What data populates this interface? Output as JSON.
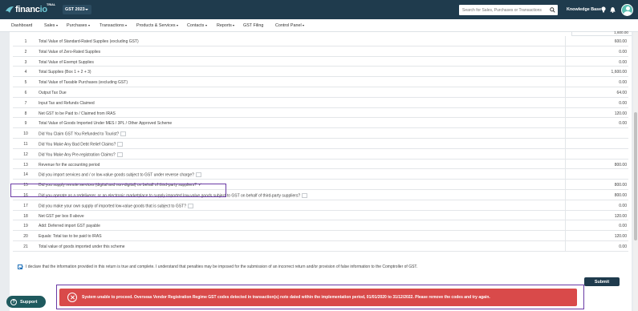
{
  "header": {
    "logo_text_a": "financ",
    "logo_text_b": "io",
    "trial_badge": "TRIAL",
    "gst_period": "GST 2023",
    "search_placeholder": "Search for Sales, Purchases or Transactions",
    "knowledge_base": "Knowledge Base"
  },
  "nav": [
    {
      "label": "Dashboard",
      "dropdown": false
    },
    {
      "label": "Sales",
      "dropdown": true
    },
    {
      "label": "Purchases",
      "dropdown": true
    },
    {
      "label": "Transactions",
      "dropdown": true
    },
    {
      "label": "Products & Services",
      "dropdown": true
    },
    {
      "label": "Contacts",
      "dropdown": true
    },
    {
      "label": "Reports",
      "dropdown": true
    },
    {
      "label": "GST Filing",
      "dropdown": false
    },
    {
      "label": "Control Panel",
      "dropdown": true
    }
  ],
  "table": {
    "partial_top_value": "1,600.00",
    "rows": [
      {
        "num": "1",
        "label": "Total Value of Standard-Rated Supplies (excluding GST)",
        "value": "600.00"
      },
      {
        "num": "2",
        "label": "Total Value of Zero-Rated Supplies",
        "value": "0.00"
      },
      {
        "num": "3",
        "label": "Total Value of Exempt Supplies",
        "value": "0.00"
      },
      {
        "num": "4",
        "label": "Total Supplies (Box 1 + 2 + 3)",
        "value": "1,600.00"
      },
      {
        "num": "5",
        "label": "Total Value of Taxable Purchases (excluding GST)",
        "value": "0.00"
      },
      {
        "num": "6",
        "label": "Output Tax Due",
        "value": "64.00"
      },
      {
        "num": "7",
        "label": "Input Tax and Refunds Claimed",
        "value": "0.00"
      },
      {
        "num": "8",
        "label": "Net GST to be Paid to / Claimed from IRAS",
        "value": "120.00"
      },
      {
        "num": "9",
        "label": "Total Value of Goods Imported Under MES / 3PL / Other Approved Scheme",
        "value": "0.00"
      },
      {
        "num": "10",
        "label": "Did You Claim GST You Refunded to Tourist?",
        "value": "",
        "checkbox": true
      },
      {
        "num": "11",
        "label": "Did You Make Any Bad Debt Relief Claims?",
        "value": "",
        "checkbox": true
      },
      {
        "num": "12",
        "label": "Did You Make Any Pre-registration Claims?",
        "value": "",
        "checkbox": true
      },
      {
        "num": "13",
        "label": "Revenue for the accounting period",
        "value": "800.00"
      },
      {
        "num": "14",
        "label": "Did you import services and / or low-value goods subject to GST under reverse charge?",
        "value": "",
        "checkbox": true
      },
      {
        "num": "15",
        "label": "Did you supply remote services (digital and non-digital) on behalf of third-party suppliers?",
        "value": "800.00",
        "checked": true
      },
      {
        "num": "16",
        "label": "Did you operate as a redeliverer, or an electronic marketplace to supply imported low-value goods subject to GST on behalf of third-party suppliers?",
        "value": "800.00",
        "checkbox": true
      },
      {
        "num": "17",
        "label": "Did you make your own supply of imported low-value goods that is subject to GST?",
        "value": "0.00",
        "checkbox": true
      },
      {
        "num": "18",
        "label": "Net GST per box 8 above",
        "value": "120.00"
      },
      {
        "num": "19",
        "label": "Add: Deferred import GST payable",
        "value": "0.00"
      },
      {
        "num": "20",
        "label": "Equals: Total tax to be paid to IRAS",
        "value": "120.00"
      },
      {
        "num": "21",
        "label": "Total value of goods imported under this scheme",
        "value": "0.00"
      }
    ]
  },
  "declaration": "I declare that the information provided in this return is true and complete. I understand that penalties may be imposed for the submission of an incorrect return and/or provision of false information to the Comptroller of GST.",
  "submit_label": "Submit",
  "alert_message": "System unable to proceed. Overseas Vendor Registration Regime GST codes detected in transaction(s) note dated within the implementation period, 01/01/2020 to 31/12/2022. Please remove the codes and try again.",
  "support_label": "Support",
  "colors": {
    "header_bg": "#1f3b4d",
    "alert_bg": "#d94a4a",
    "highlight_border": "#6a3aa5",
    "support_bg": "#1f5a5e"
  }
}
